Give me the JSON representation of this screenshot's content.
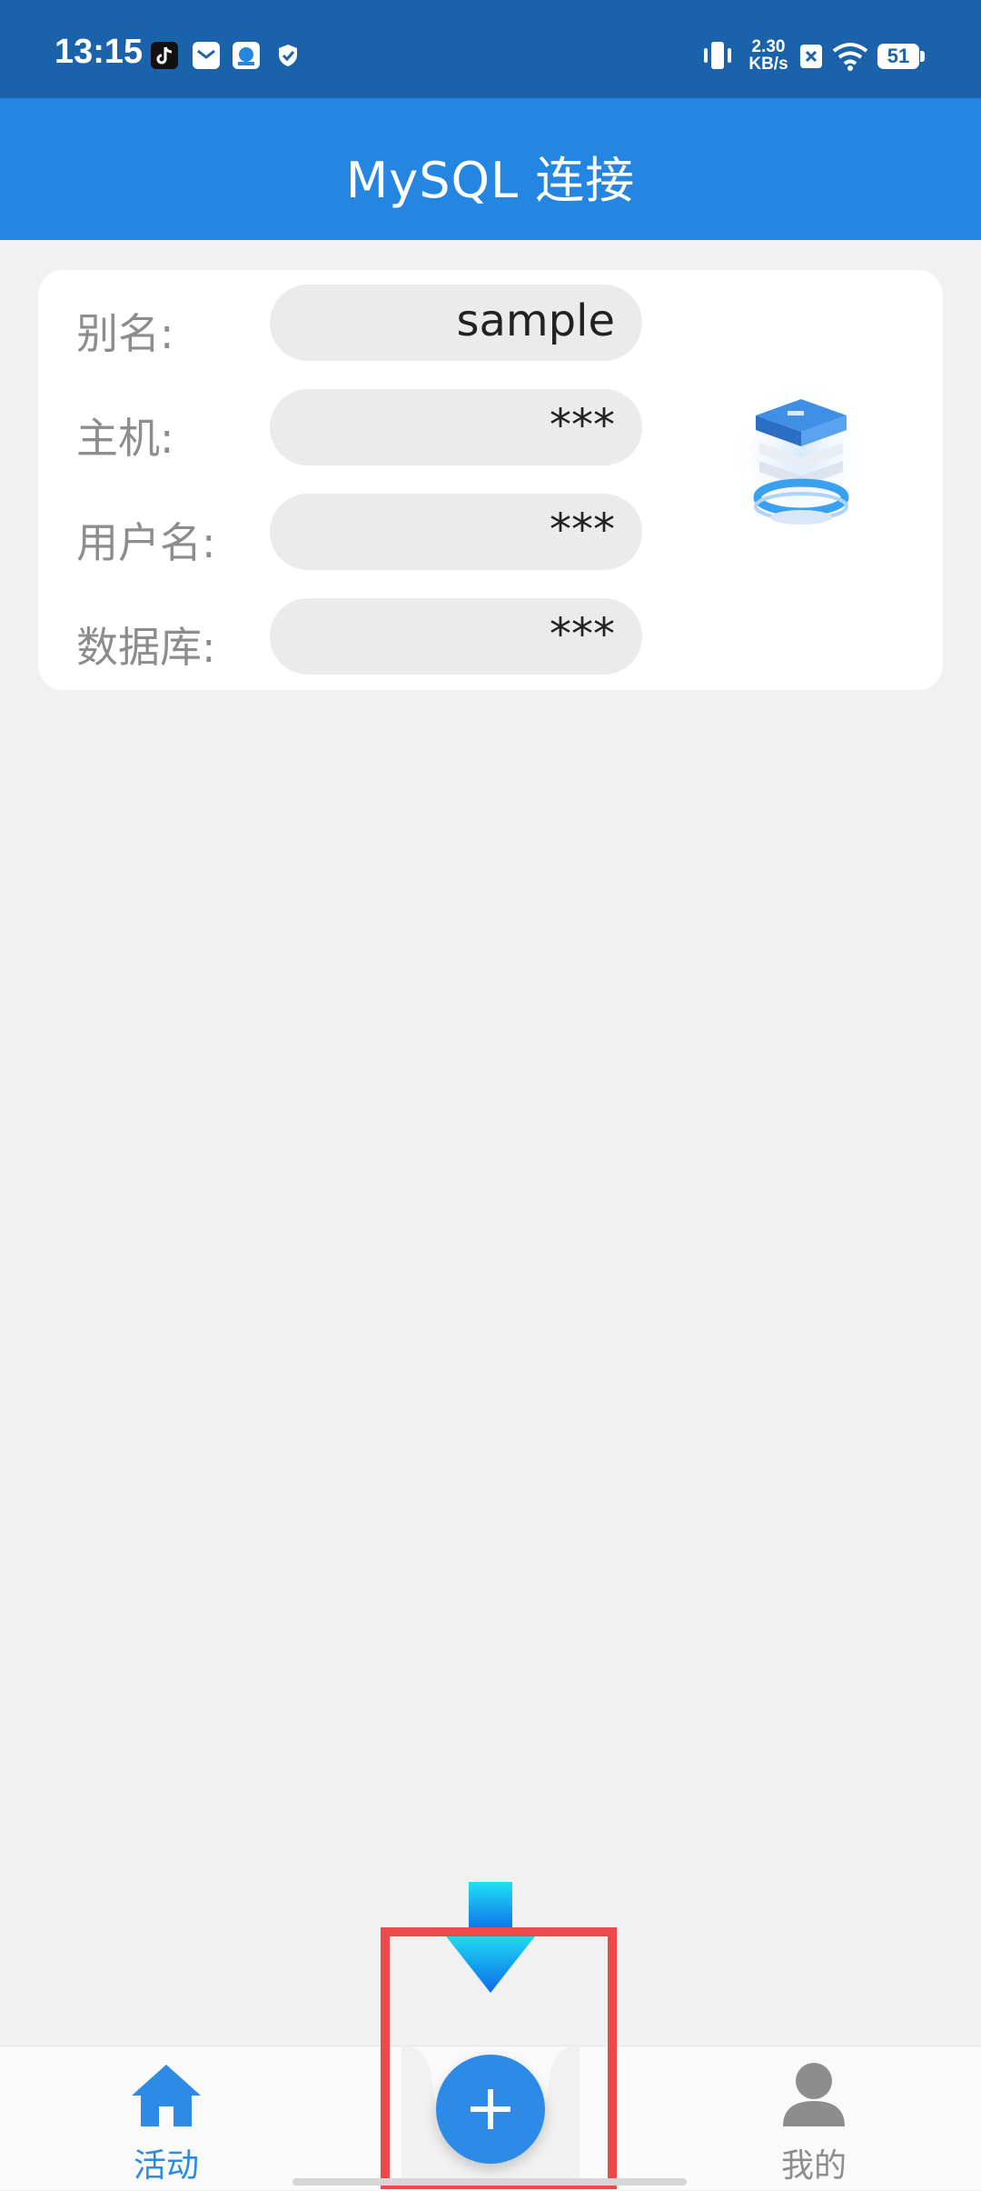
{
  "status_bar": {
    "time": "13:15",
    "network_speed_value": "2.30",
    "network_speed_unit": "KB/s",
    "battery": "51",
    "icons": [
      "tiktok-icon",
      "mail-icon",
      "cloud-app-icon",
      "shield-icon",
      "vibrate-icon",
      "sim-x-icon",
      "wifi-icon",
      "battery-icon"
    ]
  },
  "app_bar": {
    "title": "MySQL 连接"
  },
  "connection_card": {
    "rows": [
      {
        "label": "别名:",
        "value": "sample"
      },
      {
        "label": "主机:",
        "value": "***"
      },
      {
        "label": "用户名:",
        "value": "***"
      },
      {
        "label": "数据库:",
        "value": "***"
      }
    ],
    "illustration": "database-icon"
  },
  "bottom_nav": {
    "items": [
      {
        "label": "活动",
        "icon": "home-icon",
        "active": true
      },
      {
        "label": "我的",
        "icon": "person-icon",
        "active": false
      }
    ],
    "fab_icon": "plus-icon"
  },
  "colors": {
    "status_bar": "#1a62a9",
    "app_bar": "#2586e2",
    "accent": "#2d8be6",
    "highlight": "#ec4a4a",
    "inactive": "#8d8d8d"
  }
}
